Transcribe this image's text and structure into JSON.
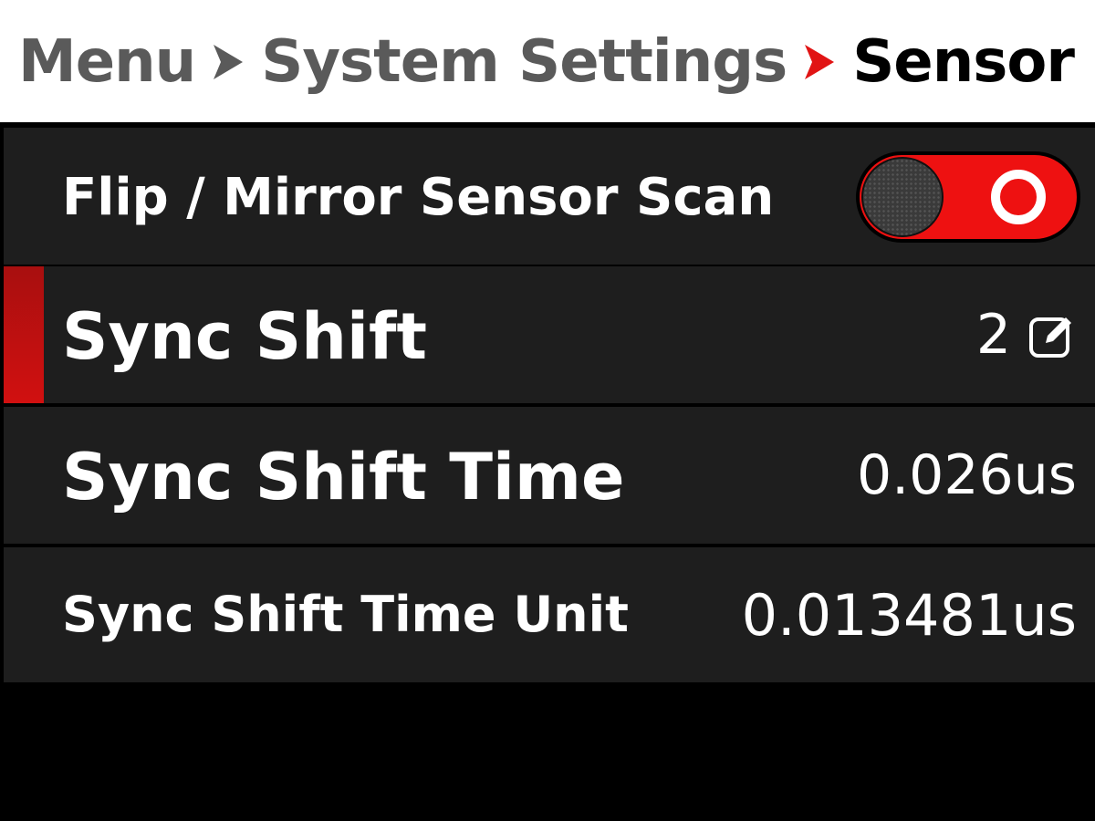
{
  "breadcrumb": {
    "items": [
      "Menu",
      "System Settings"
    ],
    "current": "Sensor"
  },
  "colors": {
    "accent": "#e11414",
    "row_bg": "#1e1e1e",
    "header_bg": "#ffffff"
  },
  "settings": [
    {
      "label": "Flip / Mirror Sensor Scan",
      "control": "toggle",
      "state": "on"
    },
    {
      "label": "Sync Shift",
      "value": "2",
      "icon": "edit-icon",
      "selected": true
    },
    {
      "label": "Sync Shift Time",
      "value": "0.026us"
    },
    {
      "label": "Sync Shift Time Unit",
      "value": "0.013481us"
    }
  ]
}
